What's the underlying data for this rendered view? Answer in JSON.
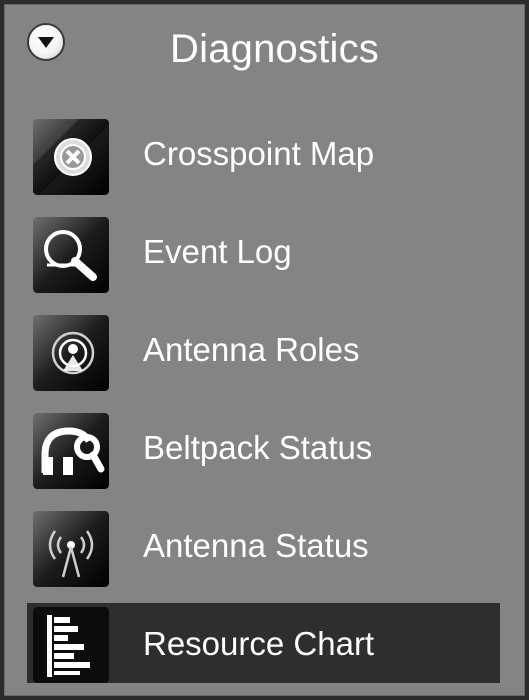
{
  "panel": {
    "title": "Diagnostics",
    "collapse_icon": "chevron-down-circle-icon"
  },
  "items": [
    {
      "label": "Crosspoint Map",
      "icon": "crosspoint-icon",
      "selected": false
    },
    {
      "label": "Event Log",
      "icon": "magnifier-icon",
      "selected": false
    },
    {
      "label": "Antenna Roles",
      "icon": "antenna-roles-icon",
      "selected": false
    },
    {
      "label": "Beltpack Status",
      "icon": "beltpack-icon",
      "selected": false
    },
    {
      "label": "Antenna Status",
      "icon": "antenna-signal-icon",
      "selected": false
    },
    {
      "label": "Resource Chart",
      "icon": "bar-chart-icon",
      "selected": true
    }
  ],
  "colors": {
    "panel_bg": "#848484",
    "selected_bg": "#2e2e2e",
    "text": "#ffffff"
  }
}
